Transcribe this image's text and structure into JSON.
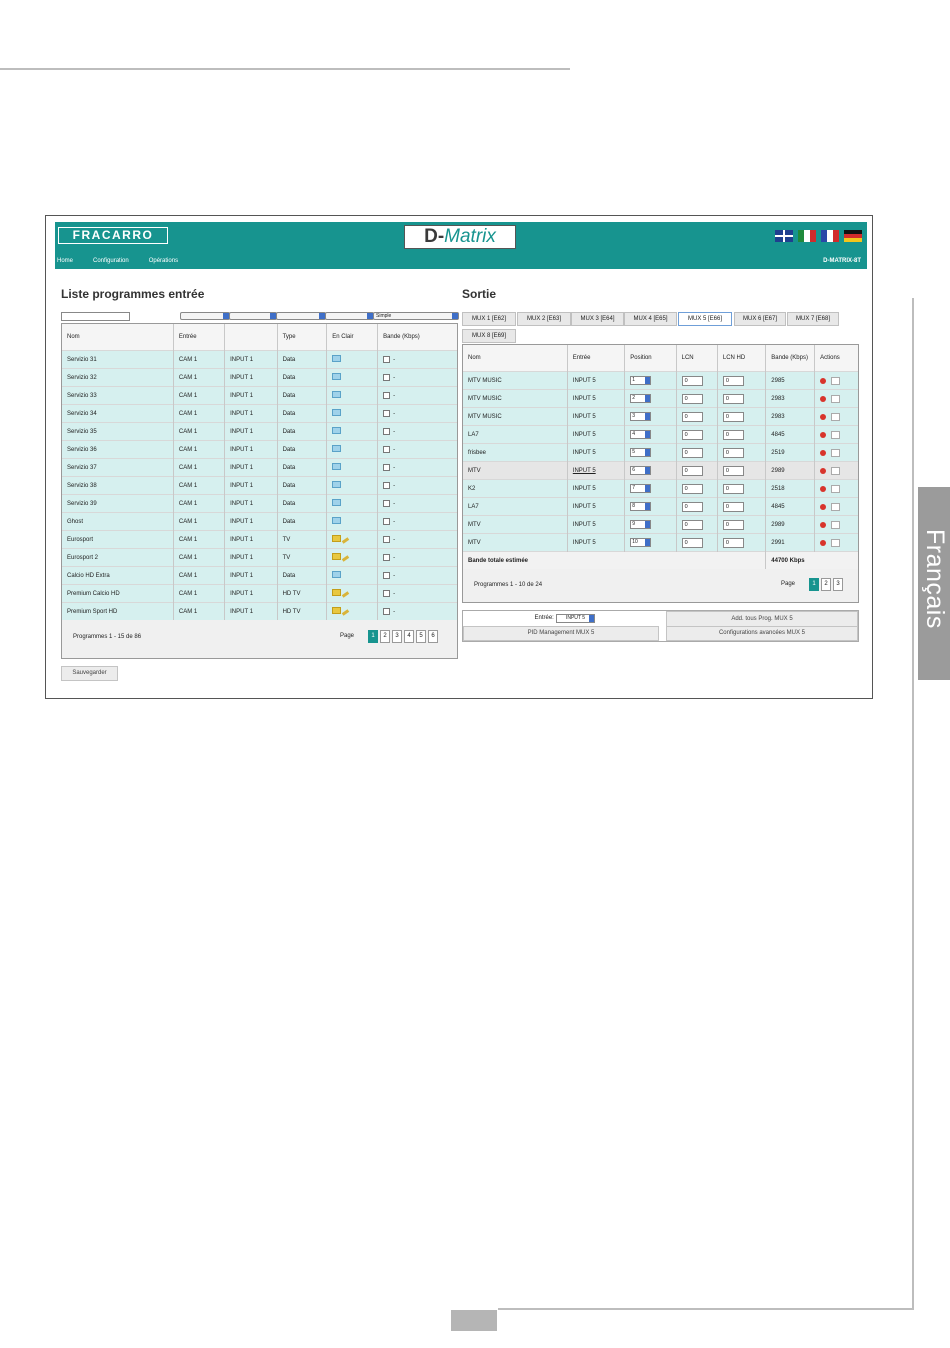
{
  "side_tab": {
    "label": "Français"
  },
  "header": {
    "brand": "FRACARRO",
    "product_prefix": "D-",
    "product_suffix": "Matrix",
    "nav": [
      "Home",
      "Configuration",
      "Opérations"
    ],
    "model": "D-MATRIX-8T",
    "flags": [
      "uk-flag-icon",
      "it-flag-icon",
      "fr-flag-icon",
      "de-flag-icon"
    ]
  },
  "input_list": {
    "title": "Liste programmes entrée",
    "filter_search": "",
    "filter_selects": [
      "",
      "",
      "",
      "",
      "Simple"
    ],
    "columns": [
      "Nom",
      "Entrée",
      "",
      "Type",
      "En Clair",
      "Bande (Kbps)"
    ],
    "rows": [
      {
        "name": "Servizio 31",
        "entree": "CAM 1",
        "input": "INPUT 1",
        "type": "Data",
        "clair": "tv",
        "bande": "-"
      },
      {
        "name": "Servizio 32",
        "entree": "CAM 1",
        "input": "INPUT 1",
        "type": "Data",
        "clair": "tv",
        "bande": "-"
      },
      {
        "name": "Servizio 33",
        "entree": "CAM 1",
        "input": "INPUT 1",
        "type": "Data",
        "clair": "tv",
        "bande": "-"
      },
      {
        "name": "Servizio 34",
        "entree": "CAM 1",
        "input": "INPUT 1",
        "type": "Data",
        "clair": "tv",
        "bande": "-"
      },
      {
        "name": "Servizio 35",
        "entree": "CAM 1",
        "input": "INPUT 1",
        "type": "Data",
        "clair": "tv",
        "bande": "-"
      },
      {
        "name": "Servizio 36",
        "entree": "CAM 1",
        "input": "INPUT 1",
        "type": "Data",
        "clair": "tv",
        "bande": "-"
      },
      {
        "name": "Servizio 37",
        "entree": "CAM 1",
        "input": "INPUT 1",
        "type": "Data",
        "clair": "tv",
        "bande": "-"
      },
      {
        "name": "Servizio 38",
        "entree": "CAM 1",
        "input": "INPUT 1",
        "type": "Data",
        "clair": "tv",
        "bande": "-"
      },
      {
        "name": "Servizio 39",
        "entree": "CAM 1",
        "input": "INPUT 1",
        "type": "Data",
        "clair": "tv",
        "bande": "-"
      },
      {
        "name": "Ghost",
        "entree": "CAM 1",
        "input": "INPUT 1",
        "type": "Data",
        "clair": "tv",
        "bande": "-"
      },
      {
        "name": "Eurosport",
        "entree": "CAM 1",
        "input": "INPUT 1",
        "type": "TV",
        "clair": "lock",
        "bande": "-"
      },
      {
        "name": "Eurosport 2",
        "entree": "CAM 1",
        "input": "INPUT 1",
        "type": "TV",
        "clair": "lock",
        "bande": "-"
      },
      {
        "name": "Calcio HD Extra",
        "entree": "CAM 1",
        "input": "INPUT 1",
        "type": "Data",
        "clair": "tv",
        "bande": "-"
      },
      {
        "name": "Premium Calcio HD",
        "entree": "CAM 1",
        "input": "INPUT 1",
        "type": "HD TV",
        "clair": "lock",
        "bande": "-"
      },
      {
        "name": "Premium Sport HD",
        "entree": "CAM 1",
        "input": "INPUT 1",
        "type": "HD TV",
        "clair": "lock",
        "bande": "-"
      }
    ],
    "footer": "Programmes 1 - 15 de 86",
    "page_label": "Page",
    "pages": [
      "1",
      "2",
      "3",
      "4",
      "5",
      "6"
    ],
    "current_page": "1",
    "save_label": "Sauvegarder"
  },
  "output": {
    "title": "Sortie",
    "tabs": [
      "MUX 1 [E62]",
      "MUX 2 [E63]",
      "MUX 3 [E64]",
      "MUX 4 [E65]",
      "MUX 5 [E66]",
      "MUX 6 [E67]",
      "MUX 7 [E68]",
      "MUX 8 [E69]"
    ],
    "active_tab": "MUX 5 [E66]",
    "columns": [
      "Nom",
      "Entrée",
      "Position",
      "LCN",
      "LCN HD",
      "Bande (Kbps)",
      "Actions"
    ],
    "rows": [
      {
        "name": "MTV MUSIC",
        "entree": "INPUT 5",
        "position": "1",
        "lcn": "0",
        "lcn_hd": "0",
        "bande": "2985"
      },
      {
        "name": "MTV MUSIC",
        "entree": "INPUT 5",
        "position": "2",
        "lcn": "0",
        "lcn_hd": "0",
        "bande": "2983"
      },
      {
        "name": "MTV MUSIC",
        "entree": "INPUT 5",
        "position": "3",
        "lcn": "0",
        "lcn_hd": "0",
        "bande": "2983"
      },
      {
        "name": "LA7",
        "entree": "INPUT 5",
        "position": "4",
        "lcn": "0",
        "lcn_hd": "0",
        "bande": "4845"
      },
      {
        "name": "frisbee",
        "entree": "INPUT 5",
        "position": "5",
        "lcn": "0",
        "lcn_hd": "0",
        "bande": "2519"
      },
      {
        "name": "MTV",
        "entree": "INPUT 5",
        "position": "6",
        "lcn": "0",
        "lcn_hd": "0",
        "bande": "2989"
      },
      {
        "name": "K2",
        "entree": "INPUT 5",
        "position": "7",
        "lcn": "0",
        "lcn_hd": "0",
        "bande": "2518"
      },
      {
        "name": "LA7",
        "entree": "INPUT 5",
        "position": "8",
        "lcn": "0",
        "lcn_hd": "0",
        "bande": "4845"
      },
      {
        "name": "MTV",
        "entree": "INPUT 5",
        "position": "9",
        "lcn": "0",
        "lcn_hd": "0",
        "bande": "2989"
      },
      {
        "name": "MTV",
        "entree": "INPUT 5",
        "position": "10",
        "lcn": "0",
        "lcn_hd": "0",
        "bande": "2991"
      }
    ],
    "highlight_row": "5",
    "total_label": "Bande totale estimée",
    "total_value": "44700 Kbps",
    "footer": "Programmes 1 - 10 de 24",
    "page_label": "Page",
    "pages": [
      "1",
      "2",
      "3"
    ],
    "current_page": "1",
    "panel": {
      "entree_label": "Entrée:",
      "entree_value": "INPUT 5",
      "add_all_label": "Add. tous Prog. MUX 5",
      "pid_label": "PID Management MUX 5",
      "advanced_label": "Configurations avancées MUX 5"
    }
  },
  "colors": {
    "teal": "#17948f",
    "row_bg": "#d6f0ef",
    "select_blue": "#3f6fc8"
  }
}
